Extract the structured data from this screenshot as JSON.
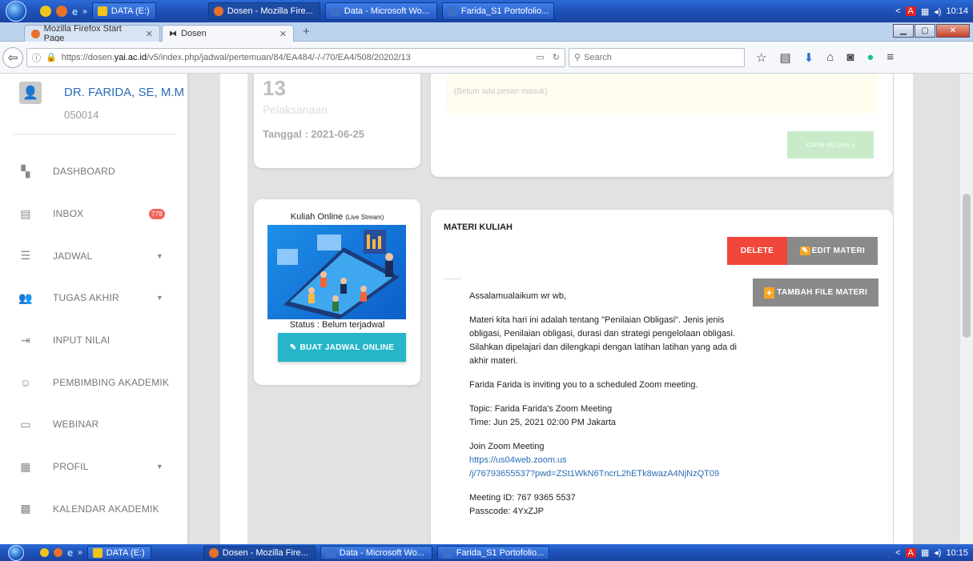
{
  "taskbar_top": {
    "items": [
      "DATA (E:)",
      "Dosen - Mozilla Fire...",
      "Data - Microsoft Wo...",
      "Farida_S1 Portofolio..."
    ],
    "clock": "10:14"
  },
  "taskbar_bottom": {
    "items": [
      "DATA (E:)",
      "Dosen - Mozilla Fire...",
      "Data - Microsoft Wo...",
      "Farida_S1 Portofolio..."
    ],
    "clock": "10:15"
  },
  "browser": {
    "tabs": [
      "Mozilla Firefox Start Page",
      "Dosen"
    ],
    "url_prefix": "https://dosen.",
    "url_domain": "yai.ac.id",
    "url_rest": "/v5/index.php/jadwal/pertemuan/84/EA484/-/-/70/EA4/508/20202/13",
    "search_placeholder": "Search"
  },
  "sidebar": {
    "name": "DR. FARIDA, SE, M.M",
    "nip": "050014",
    "items": [
      {
        "label": "DASHBOARD",
        "icon": "dashboard-icon"
      },
      {
        "label": "INBOX",
        "icon": "inbox-icon",
        "badge": "778"
      },
      {
        "label": "JADWAL",
        "icon": "list-icon"
      },
      {
        "label": "TUGAS AKHIR",
        "icon": "users-icon"
      },
      {
        "label": "INPUT NILAI",
        "icon": "input-icon"
      },
      {
        "label": "PEMBIMBING AKADEMIK",
        "icon": "advisor-icon"
      },
      {
        "label": "WEBINAR",
        "icon": "webinar-icon"
      },
      {
        "label": "PROFIL",
        "icon": "profile-icon"
      },
      {
        "label": "KALENDAR AKADEMIK",
        "icon": "calendar-icon"
      }
    ]
  },
  "session": {
    "number": "13",
    "label": "Pelaksanaan",
    "date": "Tanggal : 2021-06-25"
  },
  "messages": {
    "empty": "(Belum ada pesan masuk)",
    "send_button": "KIRIM PESAN »"
  },
  "online": {
    "title": "Kuliah Online",
    "title_small": "(Live Stream)",
    "status": "Status : Belum terjadwal",
    "button": "BUAT JADWAL ONLINE"
  },
  "materi": {
    "heading": "MATERI KULIAH",
    "delete_button": "DELETE",
    "edit_button": "EDIT MATERI",
    "add_file_button": "TAMBAH FILE MATERI",
    "greeting": "Assalamualaikum wr wb,",
    "paragraph": "Materi kita hari ini adalah tentang \"Penilaian Obligasi\". Jenis jenis obligasi, Penilaian obligasi, durasi dan strategi pengelolaan obligasi. Silahkan dipelajari dan dilengkapi dengan latihan latihan yang ada di akhir materi.",
    "invite": "Farida Farida is inviting you to a scheduled Zoom meeting.",
    "topic": "Topic: Farida Farida's Zoom Meeting",
    "time": "Time: Jun 25, 2021 02:00 PM Jakarta",
    "join_label": "Join Zoom Meeting",
    "join_link_1": "https://us04web.zoom.us",
    "join_link_2": "/j/76793655537?pwd=ZSt1WkN6TncrL2hETk8wazA4NjNzQT09",
    "meeting_id": "Meeting ID: 767 9365 5537",
    "passcode": "Passcode: 4YxZJP"
  },
  "colors": {
    "delete": "#f0473a",
    "edit": "#8a8a8a",
    "online_button": "#26b5c9",
    "send_button": "#b6e3b6",
    "accent_blue": "#2a6db5"
  }
}
